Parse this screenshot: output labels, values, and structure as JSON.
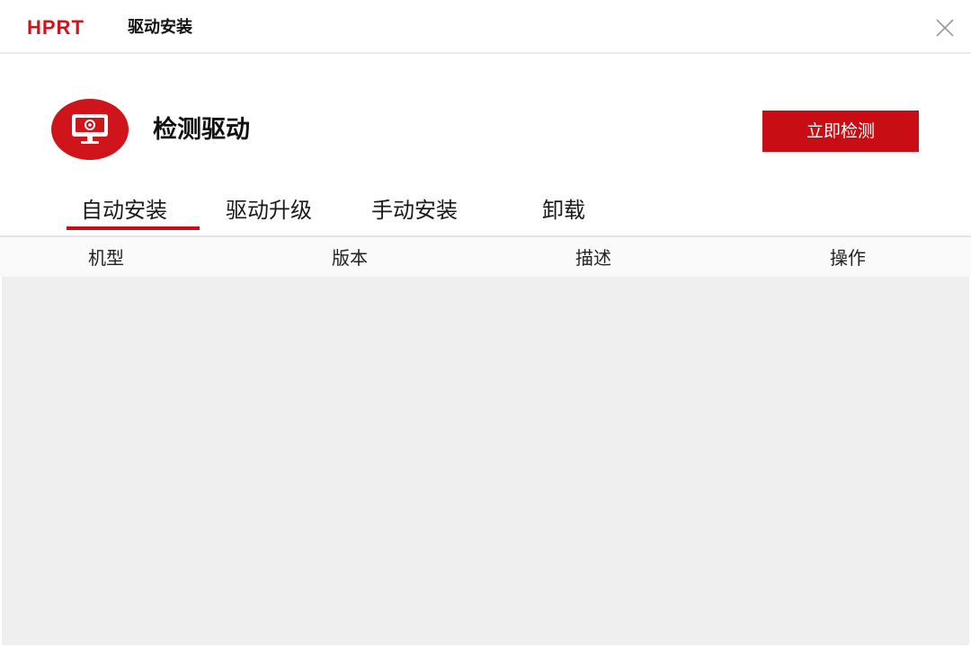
{
  "titlebar": {
    "brand": "HPRT",
    "title": "驱动安装",
    "brand_color": "#d0141b",
    "close_icon": "close-icon"
  },
  "header": {
    "icon": "monitor-icon",
    "title": "检测驱动",
    "detect_button_label": "立即检测",
    "accent_color": "#c90d14"
  },
  "tabs": [
    {
      "label": "自动安装",
      "active": true
    },
    {
      "label": "驱动升级",
      "active": false
    },
    {
      "label": "手动安装",
      "active": false
    },
    {
      "label": "卸载",
      "active": false
    }
  ],
  "table": {
    "columns": [
      "机型",
      "版本",
      "描述",
      "操作"
    ],
    "rows": []
  }
}
